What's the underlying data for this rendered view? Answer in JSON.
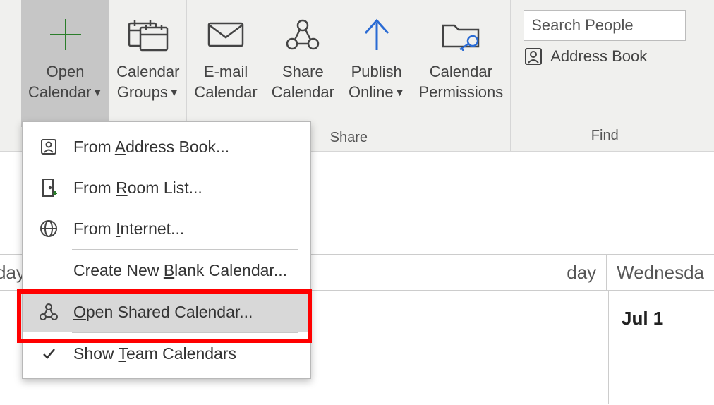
{
  "ribbon": {
    "open_calendar": {
      "line1": "Open",
      "line2": "Calendar"
    },
    "calendar_groups": {
      "line1": "Calendar",
      "line2": "Groups"
    },
    "email_calendar": {
      "line1": "E-mail",
      "line2": "Calendar"
    },
    "share_calendar": {
      "line1": "Share",
      "line2": "Calendar"
    },
    "publish_online": {
      "line1": "Publish",
      "line2": "Online"
    },
    "calendar_permissions": {
      "line1": "Calendar",
      "line2": "Permissions"
    },
    "group_share": "Share",
    "group_find": "Find",
    "search_placeholder": "Search People",
    "address_book": "Address Book"
  },
  "menu": {
    "from_address_book_pre": "From ",
    "from_address_book_m": "A",
    "from_address_book_post": "ddress Book...",
    "from_room_pre": "From ",
    "from_room_m": "R",
    "from_room_post": "oom List...",
    "from_internet_pre": "From ",
    "from_internet_m": "I",
    "from_internet_post": "nternet...",
    "create_blank_pre": "Create New ",
    "create_blank_m": "B",
    "create_blank_post": "lank Calendar...",
    "open_shared_m": "O",
    "open_shared_post": "pen Shared Calendar...",
    "show_team_pre": "Show ",
    "show_team_m": "T",
    "show_team_post": "eam Calendars"
  },
  "calendar": {
    "monday_part": "day",
    "tuesday_part": "day",
    "wednesday_part": "Wednesda",
    "jul1": "Jul 1"
  }
}
